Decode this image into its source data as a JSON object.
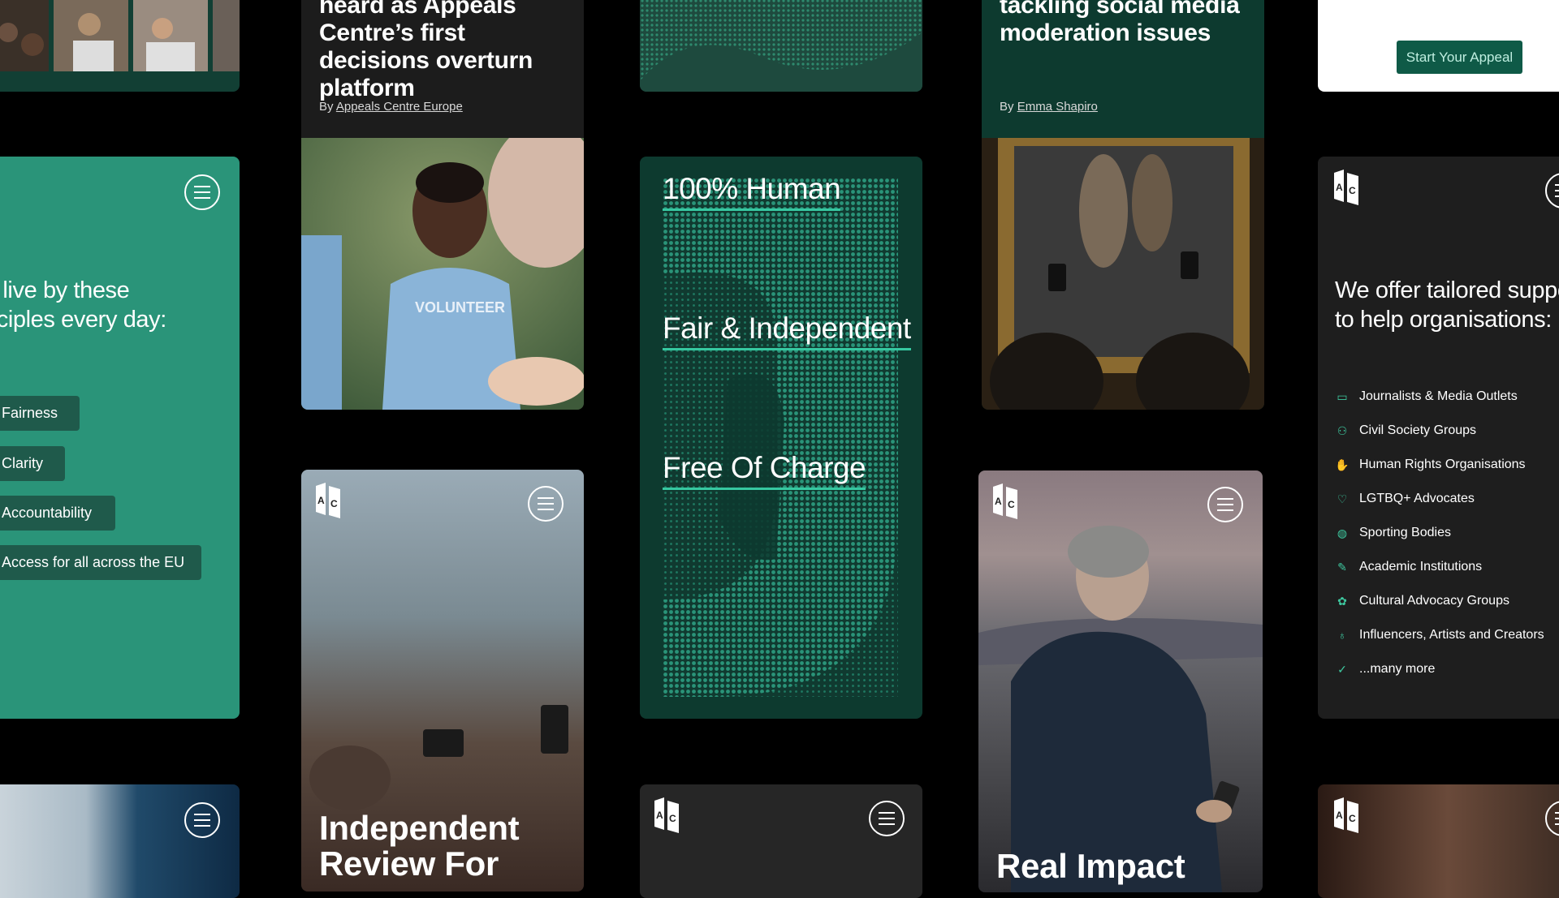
{
  "cards": {
    "appeals_article": {
      "headline": "heard as Appeals Centre’s first decisions overturn platform",
      "by_prefix": "By",
      "author": "Appeals Centre Europe"
    },
    "social_article": {
      "headline": "tackling social media moderation issues",
      "by_prefix": "By",
      "author": "Emma Shapiro"
    },
    "cta": {
      "button_label": "Start Your Appeal"
    },
    "principles": {
      "heading": "e live by these\nnciples every day:",
      "items": [
        {
          "label": "Fairness",
          "icon": "balance-icon"
        },
        {
          "label": "Clarity",
          "icon": "diamond-icon"
        },
        {
          "label": "Accountability",
          "icon": "bell-icon"
        },
        {
          "label": "Access for all across the EU",
          "icon": "globe-icon"
        }
      ]
    },
    "halftone": {
      "items": [
        "100% Human",
        "Fair & Independent",
        "Free Of Charge"
      ]
    },
    "orgs": {
      "heading": "We offer tailored suppo\nto help organisations:",
      "items": [
        {
          "label": "Journalists & Media Outlets",
          "icon": "newspaper-icon"
        },
        {
          "label": "Civil Society Groups",
          "icon": "people-icon"
        },
        {
          "label": "Human Rights Organisations",
          "icon": "hand-icon"
        },
        {
          "label": "LGTBQ+ Advocates",
          "icon": "heart-icon"
        },
        {
          "label": "Sporting Bodies",
          "icon": "ball-icon"
        },
        {
          "label": "Academic Institutions",
          "icon": "pen-icon"
        },
        {
          "label": "Cultural Advocacy Groups",
          "icon": "flower-icon"
        },
        {
          "label": "Influencers, Artists and Creators",
          "icon": "bulb-icon"
        },
        {
          "label": "...many more",
          "icon": "check-icon"
        }
      ]
    },
    "independent_review": {
      "headline": "Independent\nReview For"
    },
    "real_impact": {
      "headline": "Real Impact"
    }
  },
  "logo_text": "AC",
  "colors": {
    "accent": "#36c7a0",
    "forest": "#0d3a2f",
    "teal": "#2a9479",
    "pill": "#1f5a4b"
  }
}
